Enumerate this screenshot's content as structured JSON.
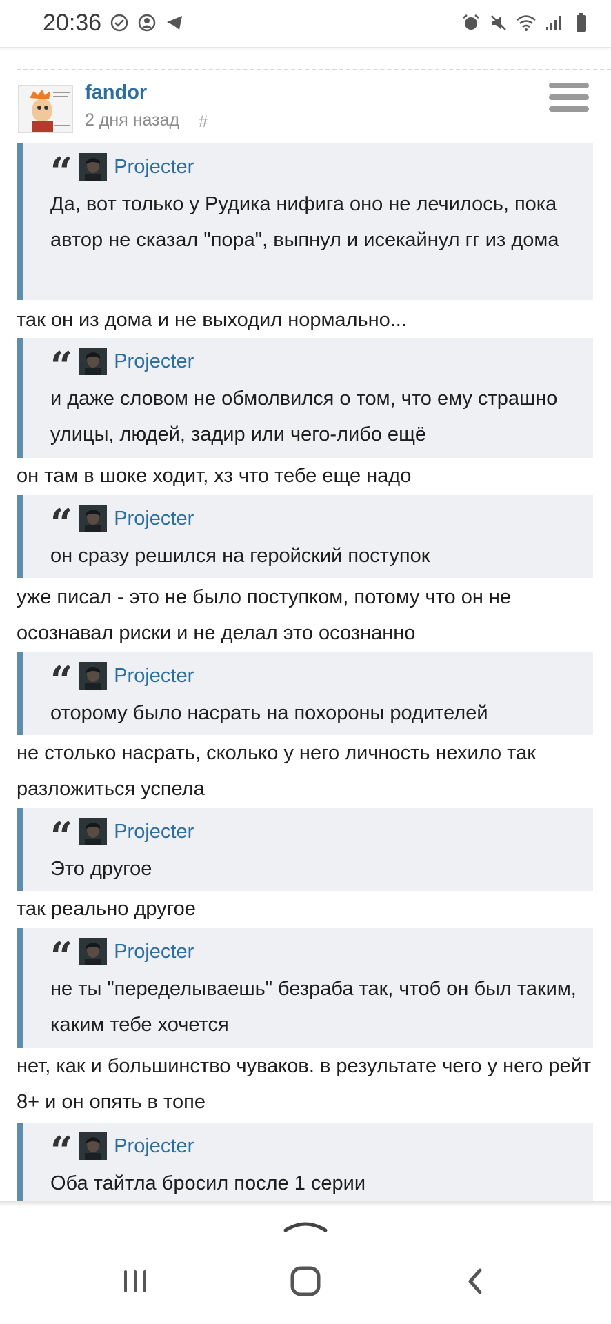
{
  "status_bar": {
    "time": "20:36",
    "left_icons": [
      "check-circle-icon",
      "account-circle-icon",
      "telegram-icon"
    ],
    "right_icons": [
      "alarm-icon",
      "mute-icon",
      "wifi-icon",
      "signal-icon",
      "battery-icon"
    ]
  },
  "post": {
    "author": "fandor",
    "time": "2 дня назад",
    "permalink": "#"
  },
  "thread": [
    {
      "quote_author": "Projecter",
      "quote": "Да, вот только у Рудика нифига оно не лечилось, пока автор не сказал \"пора\", выпнул и исекайнул гг из дома",
      "reply": "так он из дома и не выходил нормально..."
    },
    {
      "quote_author": "Projecter",
      "quote": "и даже словом не обмолвился о том, что ему страшно улицы, людей, задир или чего-либо ещё",
      "reply": "он там в шоке ходит, хз что тебе еще надо"
    },
    {
      "quote_author": "Projecter",
      "quote": "он сразу решился на геройский поступок",
      "reply": "уже писал - это не было поступком, потому что он не осознавал риски и не делал это осознанно"
    },
    {
      "quote_author": "Projecter",
      "quote": "оторому было насрать на похороны родителей",
      "reply": "не столько насрать, сколько у него личность нехило так разложиться успела"
    },
    {
      "quote_author": "Projecter",
      "quote": "Это другое",
      "reply": "так реально другое"
    },
    {
      "quote_author": "Projecter",
      "quote": "не ты \"переделываешь\" безраба так, чтоб он был таким, каким тебе хочется",
      "reply": "нет, как и большинство чуваков. в результате чего у него рейт 8+ и он опять в топе"
    },
    {
      "quote_author": "Projecter",
      "quote": "Оба тайтла бросил после 1 серии",
      "reply": ""
    }
  ],
  "colors": {
    "link": "#2d6ea0",
    "quote_bg": "#eef0f3",
    "quote_border": "#5e8eac"
  }
}
